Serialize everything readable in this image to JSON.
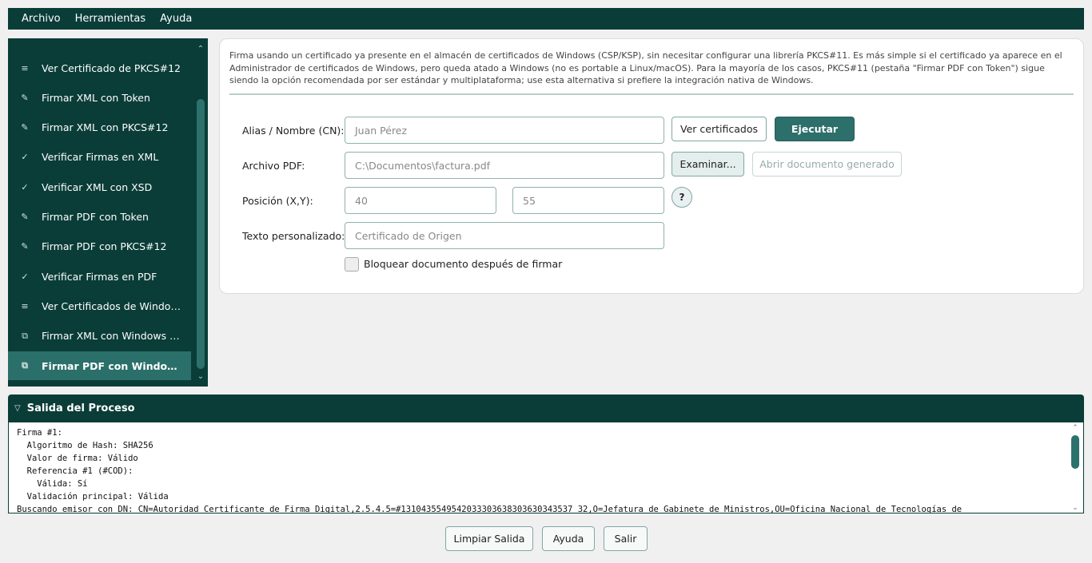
{
  "menu": {
    "archivo": "Archivo",
    "herramientas": "Herramientas",
    "ayuda": "Ayuda"
  },
  "sidebar": {
    "items": [
      {
        "icon": "≡",
        "label": "Ver Certificado de PKCS#12"
      },
      {
        "icon": "✎",
        "label": "Firmar XML con Token"
      },
      {
        "icon": "✎",
        "label": "Firmar XML con PKCS#12"
      },
      {
        "icon": "✓",
        "label": "Verificar Firmas en XML"
      },
      {
        "icon": "✓",
        "label": "Verificar XML con XSD"
      },
      {
        "icon": "✎",
        "label": "Firmar PDF con Token"
      },
      {
        "icon": "✎",
        "label": "Firmar PDF con PKCS#12"
      },
      {
        "icon": "✓",
        "label": "Verificar Firmas en PDF"
      },
      {
        "icon": "≡",
        "label": "Ver Certificados de Windows"
      },
      {
        "icon": "⧉",
        "label": "Firmar XML con Windows CS..."
      },
      {
        "icon": "⧉",
        "label": "Firmar PDF con Windows ..."
      }
    ],
    "active_index": 10
  },
  "panel": {
    "description": "Firma usando un certificado ya presente en el almacén de certificados de Windows (CSP/KSP), sin necesitar configurar una librería PKCS#11. Es más simple si el certificado ya aparece en el Administrador de certificados de Windows, pero queda atado a Windows (no es portable a Linux/macOS). Para la mayoría de los casos, PKCS#11 (pestaña \"Firmar PDF con Token\") sigue siendo la opción recomendada por ser estándar y multiplataforma; use esta alternativa si prefiere la integración nativa de Windows.",
    "alias_label": "Alias / Nombre (CN):",
    "alias_placeholder": "Juan Pérez",
    "ver_certificados": "Ver certificados",
    "ejecutar": "Ejecutar",
    "archivo_label": "Archivo PDF:",
    "archivo_placeholder": "C:\\Documentos\\factura.pdf",
    "examinar": "Examinar...",
    "abrir_documento": "Abrir documento generado",
    "posicion_label": "Posición (X,Y):",
    "pos_x_placeholder": "40",
    "pos_y_placeholder": "55",
    "help_glyph": "?",
    "texto_label": "Texto personalizado:",
    "texto_placeholder": "Certificado de Origen",
    "bloquear_label": "Bloquear documento después de firmar",
    "bloquear_checked": false
  },
  "output": {
    "title": "Salida del Proceso",
    "lines": [
      "Firma #1:",
      "  Algoritmo de Hash: SHA256",
      "  Valor de firma: Válido",
      "  Referencia #1 (#COD):",
      "    Válida: Sí",
      "  Validación principal: Válida",
      "Buscando emisor con DN: CN=Autoridad Certificante de Firma Digital,2.5.4.5=#1310435549542033303638303630343537 32,O=Jefatura de Gabinete de Ministros,OU=Oficina Nacional de Tecnologías de"
    ]
  },
  "bottom": {
    "limpiar": "Limpiar Salida",
    "ayuda": "Ayuda",
    "salir": "Salir"
  },
  "colors": {
    "dark": "#0a3d38",
    "accent": "#2d6f6a",
    "active": "#2b6f6a"
  }
}
